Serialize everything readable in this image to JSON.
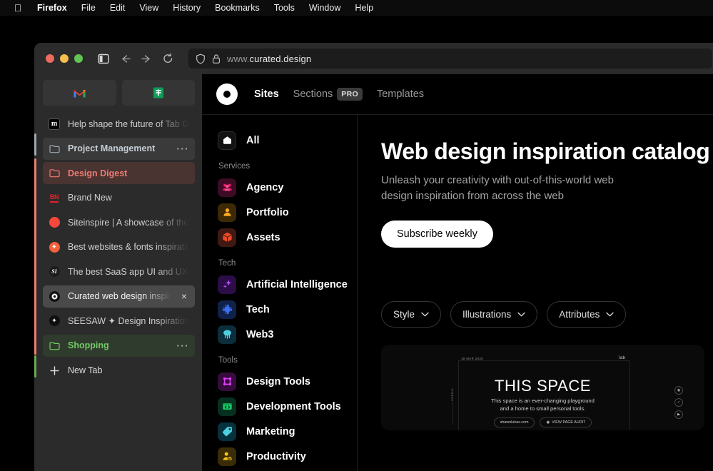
{
  "menubar": {
    "apple_icon": "apple-icon",
    "items": [
      "Firefox",
      "File",
      "Edit",
      "View",
      "History",
      "Bookmarks",
      "Tools",
      "Window",
      "Help"
    ]
  },
  "toolbar": {
    "back_icon": "back-arrow-icon",
    "forward_icon": "forward-arrow-icon",
    "reload_icon": "reload-icon",
    "sidebar_icon": "sidebar-toggle-icon",
    "shield_icon": "shield-icon",
    "lock_icon": "lock-icon",
    "url_prefix": "www.",
    "url_main": "curated.design"
  },
  "sidebar": {
    "pinned": [
      {
        "name": "gmail-pinned-tab",
        "icon": "gmail-icon"
      },
      {
        "name": "sheets-pinned-tab",
        "icon": "google-sheets-icon"
      }
    ],
    "tabs": [
      {
        "label": "Help shape the future of Tab Groups i",
        "icon": "medium-favicon",
        "type": "tab"
      },
      {
        "label": "Project Management",
        "icon": "folder-icon",
        "type": "group",
        "style": "g-pm",
        "menu": "···"
      },
      {
        "label": "Design Digest",
        "icon": "folder-icon",
        "type": "group",
        "style": "g-dd"
      },
      {
        "label": "Brand New",
        "icon": "brandnew-favicon",
        "type": "tab"
      },
      {
        "label": "Siteinspire | A showcase of the web's",
        "icon": "siteinspire-favicon",
        "type": "tab"
      },
      {
        "label": "Best websites & fonts inspiration feed",
        "icon": "inspiration-feed-favicon",
        "type": "tab"
      },
      {
        "label": "The best SaaS app UI and UX example",
        "icon": "saas-favicon",
        "type": "tab"
      },
      {
        "label": "Curated web design inspiration ca",
        "icon": "curated-favicon",
        "type": "tab",
        "active": true,
        "close": "×"
      },
      {
        "label": "SEESAW ✦ Design Inspiration",
        "icon": "seesaw-favicon",
        "type": "tab"
      },
      {
        "label": "Shopping",
        "icon": "folder-icon",
        "type": "group",
        "style": "g-sh",
        "menu": "···"
      }
    ],
    "new_tab": {
      "label": "New Tab",
      "icon": "plus-icon"
    }
  },
  "site": {
    "logo_icon": "curated-logo-icon",
    "nav": [
      {
        "label": "Sites",
        "active": true
      },
      {
        "label": "Sections",
        "badge": "PRO"
      },
      {
        "label": "Templates"
      }
    ],
    "categories": {
      "all": {
        "label": "All",
        "icon": "home-pentagon-icon"
      },
      "groups": [
        {
          "heading": "Services",
          "items": [
            {
              "label": "Agency",
              "icon": "people-icon"
            },
            {
              "label": "Portfolio",
              "icon": "person-icon"
            },
            {
              "label": "Assets",
              "icon": "cube-icon"
            }
          ]
        },
        {
          "heading": "Tech",
          "items": [
            {
              "label": "Artificial Intelligence",
              "icon": "sparkles-icon"
            },
            {
              "label": "Tech",
              "icon": "chip-icon"
            },
            {
              "label": "Web3",
              "icon": "tree-icon"
            }
          ]
        },
        {
          "heading": "Tools",
          "items": [
            {
              "label": "Design Tools",
              "icon": "frame-icon"
            },
            {
              "label": "Development Tools",
              "icon": "code-window-icon"
            },
            {
              "label": "Marketing",
              "icon": "tag-icon"
            },
            {
              "label": "Productivity",
              "icon": "person-check-icon"
            }
          ]
        }
      ]
    },
    "hero": {
      "title": "Web design inspiration catalog",
      "subtitle": "Unleash your creativity with out-of-this-world web design inspiration from across the web",
      "cta": "Subscribe weekly"
    },
    "filters": [
      {
        "label": "Style",
        "icon": "chevron-down-icon"
      },
      {
        "label": "Illustrations",
        "icon": "chevron-down-icon"
      },
      {
        "label": "Attributes",
        "icon": "chevron-down-icon"
      }
    ],
    "card": {
      "title": "THIS SPACE",
      "line1": "This space is an ever-changing playground",
      "line2": "and a home to small personal tools.",
      "pill_site": "shawnlukas.com",
      "pill_audit": "VIEW PAGE AUDIT",
      "date": "18 MAR 2025",
      "lab": "lab",
      "scroll": "SCROLL"
    }
  },
  "colors": {
    "accent_red": "#f07a70",
    "accent_green": "#72c866",
    "accent_gray": "#9aa7b0",
    "page_bg": "#000000",
    "chrome_bg": "#2b2b2b"
  }
}
